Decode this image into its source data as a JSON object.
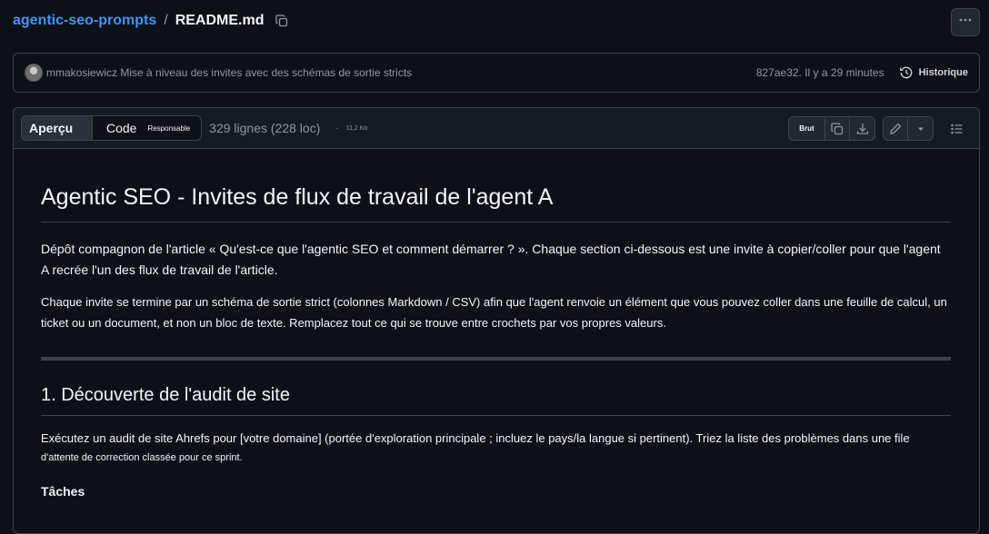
{
  "breadcrumb": {
    "repo": "agentic-seo-prompts",
    "separator": "/",
    "file": "README.md"
  },
  "icons": {
    "copy": "copy-icon",
    "more": "kebab-horizontal-icon",
    "history": "history-icon",
    "copy_raw": "copy-icon",
    "download": "download-icon",
    "edit": "pencil-icon",
    "dropdown": "triangle-down-icon",
    "outline": "list-unordered-icon"
  },
  "commit": {
    "author": "mmakosiewicz",
    "message": "Mise à niveau des invites avec des schémas de sortie stricts",
    "meta": "827ae32. Il y a 29 minutes",
    "history_label": "Historique"
  },
  "file_header": {
    "tab_preview": "Aperçu",
    "tab_code": "Code",
    "tab_blame": "Responsable",
    "lines": "329 lignes (228 loc)",
    "dot": "·",
    "size": "11,2 Ko",
    "raw_label": "Brut"
  },
  "readme": {
    "title": "Agentic SEO - Invites de flux de travail de l'agent A",
    "intro": "Dépôt compagnon de l'article « Qu'est-ce que l'agentic SEO et comment démarrer ? ». Chaque section ci-dessous est une invite à copier/coller pour que l'agent A recrée l'un des flux de travail de l'article.",
    "schema_note": "Chaque invite se termine par un schéma de sortie strict (colonnes Markdown / CSV) afin que l'agent renvoie un élément que vous pouvez coller dans une feuille de calcul, un ticket ou un document, et non un bloc de texte. Remplacez tout ce qui se trouve entre crochets par vos propres valeurs.",
    "section1_title": "1. Découverte de l'audit de site",
    "section1_line1": "Exécutez un audit de site Ahrefs pour [votre domaine] (portée d'exploration principale ; incluez le pays/la langue si pertinent). Triez la liste des problèmes dans une file",
    "section1_line2": "d'attente de correction classée pour ce sprint.",
    "tasks_label": "Tâches"
  },
  "colors": {
    "background": "#0d1117",
    "link": "#4493f8",
    "border": "#3d444d",
    "muted_text": "#9198a1"
  }
}
